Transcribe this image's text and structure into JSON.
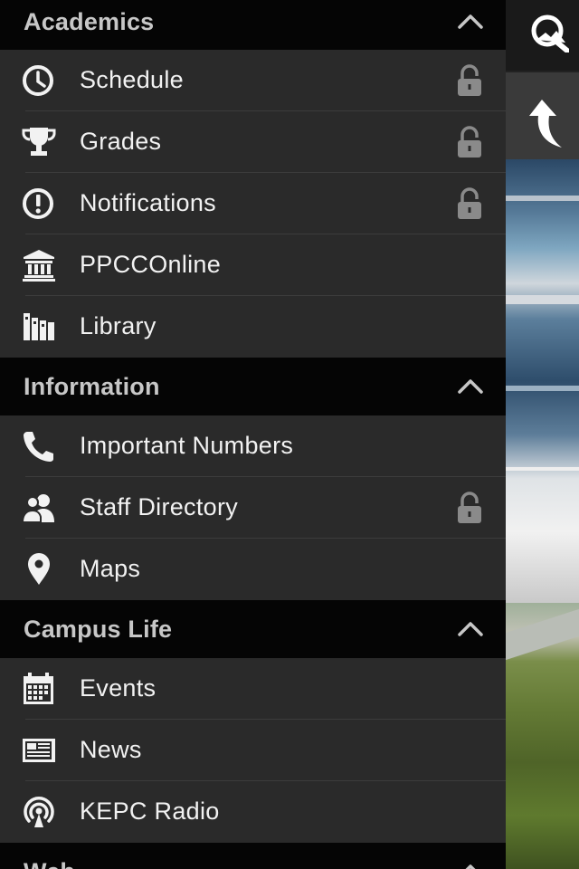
{
  "sections": [
    {
      "title": "Academics",
      "items": [
        {
          "label": "Schedule",
          "icon": "clock-icon",
          "locked": true
        },
        {
          "label": "Grades",
          "icon": "trophy-icon",
          "locked": true
        },
        {
          "label": "Notifications",
          "icon": "exclamation-icon",
          "locked": true
        },
        {
          "label": "PPCCOnline",
          "icon": "institution-icon",
          "locked": false
        },
        {
          "label": "Library",
          "icon": "books-icon",
          "locked": false
        }
      ]
    },
    {
      "title": "Information",
      "items": [
        {
          "label": "Important Numbers",
          "icon": "phone-icon",
          "locked": false
        },
        {
          "label": "Staff Directory",
          "icon": "people-icon",
          "locked": true
        },
        {
          "label": "Maps",
          "icon": "map-pin-icon",
          "locked": false
        }
      ]
    },
    {
      "title": "Campus Life",
      "items": [
        {
          "label": "Events",
          "icon": "calendar-icon",
          "locked": false
        },
        {
          "label": "News",
          "icon": "newspaper-icon",
          "locked": false
        },
        {
          "label": "KEPC Radio",
          "icon": "radio-tower-icon",
          "locked": false
        }
      ]
    },
    {
      "title": "Web",
      "items": []
    }
  ],
  "colors": {
    "menu_background": "#2a2a2a",
    "header_background": "#050505",
    "text": "#f2f2f2",
    "header_text": "#c7c7c7",
    "lock": "#8a8a8a"
  }
}
